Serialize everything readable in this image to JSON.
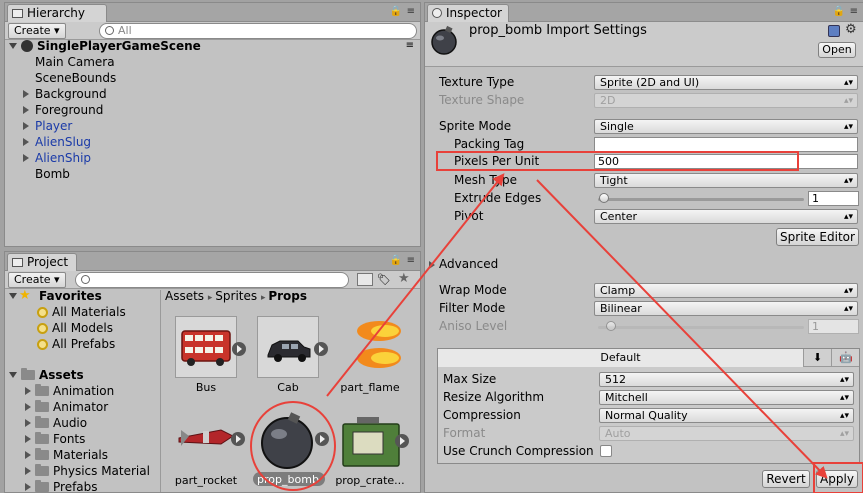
{
  "hierarchy": {
    "tab_label": "Hierarchy",
    "create_label": "Create ▾",
    "search_placeholder": "All",
    "scene_name": "SinglePlayerGameScene",
    "items": [
      {
        "label": "Main Camera",
        "foldout": false,
        "prefab": false
      },
      {
        "label": "SceneBounds",
        "foldout": false,
        "prefab": false
      },
      {
        "label": "Background",
        "foldout": true,
        "prefab": false
      },
      {
        "label": "Foreground",
        "foldout": true,
        "prefab": false
      },
      {
        "label": "Player",
        "foldout": true,
        "prefab": true
      },
      {
        "label": "AlienSlug",
        "foldout": true,
        "prefab": true
      },
      {
        "label": "AlienShip",
        "foldout": true,
        "prefab": true
      },
      {
        "label": "Bomb",
        "foldout": false,
        "prefab": false
      }
    ]
  },
  "project": {
    "tab_label": "Project",
    "create_label": "Create ▾",
    "favorites_label": "Favorites",
    "favorites": [
      "All Materials",
      "All Models",
      "All Prefabs"
    ],
    "assets_label": "Assets",
    "folders": [
      "Animation",
      "Animator",
      "Audio",
      "Fonts",
      "Materials",
      "Physics Material",
      "Prefabs"
    ],
    "breadcrumb": [
      "Assets",
      "Sprites",
      "Props"
    ],
    "thumbnails": [
      "Bus",
      "Cab",
      "part_flame",
      "part_rocket",
      "prop_bomb",
      "prop_crate..."
    ],
    "selected_thumbnail": "prop_bomb"
  },
  "inspector": {
    "tab_label": "Inspector",
    "title": "prop_bomb Import Settings",
    "open_label": "Open",
    "texture_type_label": "Texture Type",
    "texture_type_value": "Sprite (2D and UI)",
    "texture_shape_label": "Texture Shape",
    "texture_shape_value": "2D",
    "sprite_mode_label": "Sprite Mode",
    "sprite_mode_value": "Single",
    "packing_tag_label": "Packing Tag",
    "packing_tag_value": "",
    "ppu_label": "Pixels Per Unit",
    "ppu_value": "500",
    "mesh_type_label": "Mesh Type",
    "mesh_type_value": "Tight",
    "extrude_label": "Extrude Edges",
    "extrude_value": "1",
    "pivot_label": "Pivot",
    "pivot_value": "Center",
    "sprite_editor_label": "Sprite Editor",
    "advanced_label": "Advanced",
    "wrap_mode_label": "Wrap Mode",
    "wrap_mode_value": "Clamp",
    "filter_mode_label": "Filter Mode",
    "filter_mode_value": "Bilinear",
    "aniso_label": "Aniso Level",
    "aniso_value": "1",
    "platform_default_label": "Default",
    "max_size_label": "Max Size",
    "max_size_value": "512",
    "resize_label": "Resize Algorithm",
    "resize_value": "Mitchell",
    "compression_label": "Compression",
    "compression_value": "Normal Quality",
    "format_label": "Format",
    "format_value": "Auto",
    "crunch_label": "Use Crunch Compression",
    "revert_label": "Revert",
    "apply_label": "Apply"
  },
  "annotations": {
    "color": "#e8413a"
  }
}
